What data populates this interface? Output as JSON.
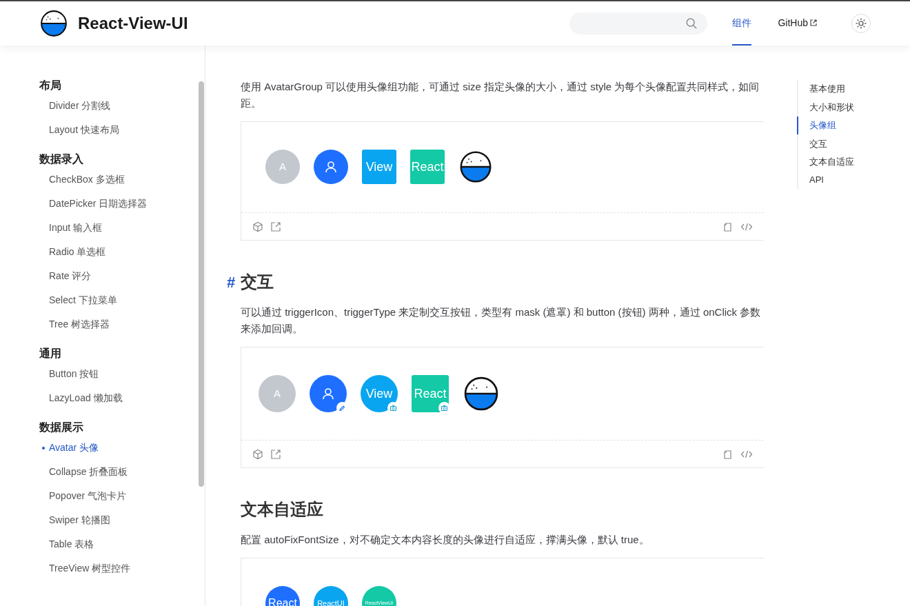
{
  "header": {
    "logo_text": "React-View-UI",
    "nav": [
      {
        "label": "组件",
        "selected": true
      },
      {
        "label": "GitHub",
        "selected": false,
        "external": true
      }
    ]
  },
  "sidebar": {
    "groups": [
      {
        "title": "布局",
        "items": [
          {
            "label": "Divider 分割线",
            "selected": false
          },
          {
            "label": "Layout 快速布局",
            "selected": false
          }
        ]
      },
      {
        "title": "数据录入",
        "items": [
          {
            "label": "CheckBox 多选框",
            "selected": false
          },
          {
            "label": "DatePicker 日期选择器",
            "selected": false
          },
          {
            "label": "Input 输入框",
            "selected": false
          },
          {
            "label": "Radio 单选框",
            "selected": false
          },
          {
            "label": "Rate 评分",
            "selected": false
          },
          {
            "label": "Select 下拉菜单",
            "selected": false
          },
          {
            "label": "Tree 树选择器",
            "selected": false
          }
        ]
      },
      {
        "title": "通用",
        "items": [
          {
            "label": "Button 按钮",
            "selected": false
          },
          {
            "label": "LazyLoad 懒加载",
            "selected": false
          }
        ]
      },
      {
        "title": "数据展示",
        "items": [
          {
            "label": "Avatar 头像",
            "selected": true
          },
          {
            "label": "Collapse 折叠面板",
            "selected": false
          },
          {
            "label": "Popover 气泡卡片",
            "selected": false
          },
          {
            "label": "Swiper 轮播图",
            "selected": false
          },
          {
            "label": "Table 表格",
            "selected": false
          },
          {
            "label": "TreeView 树型控件",
            "selected": false
          }
        ]
      }
    ]
  },
  "sections": [
    {
      "description": "使用 AvatarGroup 可以使用头像组功能，可通过 size 指定头像的大小，通过 style 为每个头像配置共同样式，如间距。",
      "demo": {
        "kind": "group",
        "toolbar": true,
        "avatars": [
          {
            "kind": "text",
            "square": false,
            "text": "A",
            "color": "#c3c8cf"
          },
          {
            "kind": "icon",
            "square": false,
            "color": "#1e6fff"
          },
          {
            "kind": "text",
            "square": true,
            "text": "View",
            "color": "#0aa5f0"
          },
          {
            "kind": "text",
            "square": true,
            "text": "React",
            "color": "#13c9a6"
          },
          {
            "kind": "logo"
          }
        ]
      }
    },
    {
      "title": "交互",
      "anchor": "#",
      "description": "可以通过 triggerIcon、triggerType 来定制交互按钮，类型有 mask (遮罩) 和 button (按钮) 两种，通过 onClick 参数来添加回调。",
      "demo": {
        "kind": "interactive",
        "toolbar": true,
        "avatars": [
          {
            "kind": "text",
            "square": false,
            "text": "A",
            "color": "#c3c8cf"
          },
          {
            "kind": "icon",
            "square": false,
            "color": "#1e6fff",
            "edit_button": true
          },
          {
            "kind": "text",
            "square": false,
            "text": "View",
            "color": "#0aa5f0",
            "camera_button": true
          },
          {
            "kind": "text",
            "square": true,
            "text": "React",
            "color": "#13c9a6",
            "camera_button": true
          },
          {
            "kind": "logo"
          }
        ]
      }
    },
    {
      "title": "文本自适应",
      "description": "配置 autoFixFontSize，对不确定文本内容长度的头像进行自适应，撑满头像，默认 true。",
      "demo": {
        "kind": "autofit",
        "avatars": [
          {
            "kind": "text",
            "square": false,
            "text": "React",
            "color": "#1e6fff"
          },
          {
            "kind": "text",
            "square": false,
            "text": "ReactUI",
            "color": "#0aa5f0"
          },
          {
            "kind": "text",
            "square": false,
            "text": "ReactViewUI",
            "color": "#13c9a6"
          }
        ]
      }
    }
  ],
  "toc": [
    {
      "label": "基本使用",
      "selected": false
    },
    {
      "label": "大小和形状",
      "selected": false
    },
    {
      "label": "头像组",
      "selected": true
    },
    {
      "label": "交互",
      "selected": false
    },
    {
      "label": "文本自适应",
      "selected": false
    },
    {
      "label": "API",
      "selected": false
    }
  ]
}
